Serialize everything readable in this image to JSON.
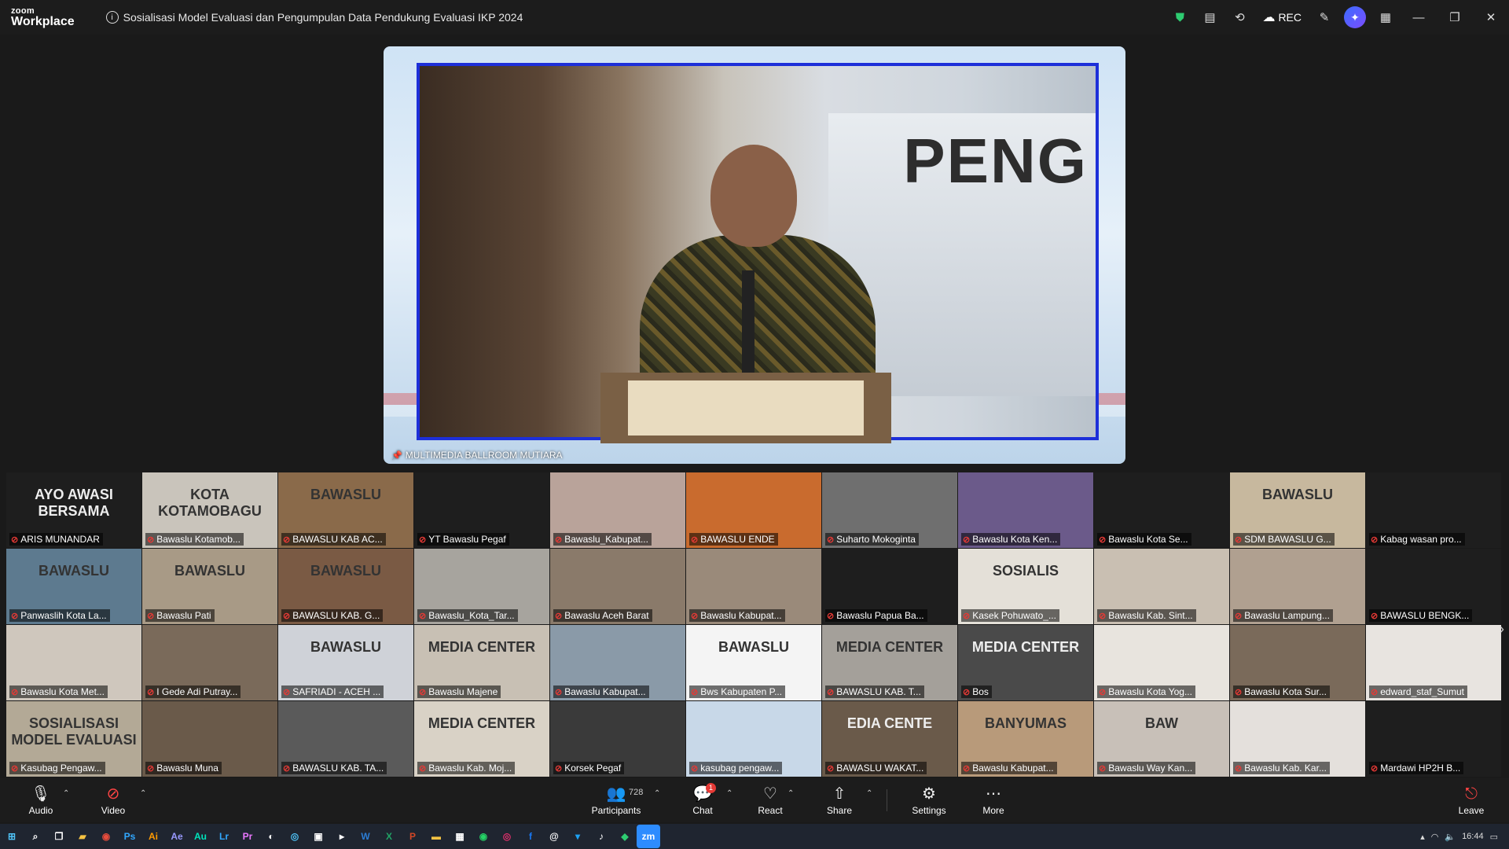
{
  "app": {
    "brand_small": "zoom",
    "brand_large": "Workplace",
    "meeting_title": "Sosialisasi Model Evaluasi dan Pengumpulan Data Pendukung Evaluasi IKP 2024",
    "rec_label": "REC"
  },
  "stage": {
    "speaker_label": "MULTIMEDIA BALLROOM MUTIARA",
    "banner_text": "PENG"
  },
  "participants": [
    {
      "name": "ARIS MUNANDAR",
      "bg": "#1e1e1e",
      "logo": "AYO AWASI BERSAMA"
    },
    {
      "name": "Bawaslu Kotamob...",
      "bg": "#c9c4bb",
      "logo": "KOTA KOTAMOBAGU"
    },
    {
      "name": "BAWASLU KAB AC...",
      "bg": "#8a6a4a",
      "logo": "BAWASLU"
    },
    {
      "name": "YT Bawaslu Pegaf",
      "bg": "#1e1e1e",
      "logo": ""
    },
    {
      "name": "Bawaslu_Kabupat...",
      "bg": "#b9a39a",
      "logo": ""
    },
    {
      "name": "BAWASLU ENDE",
      "bg": "#c96b2e",
      "logo": ""
    },
    {
      "name": "Suharto Mokoginta",
      "bg": "#6f6f6f",
      "logo": ""
    },
    {
      "name": "Bawaslu Kota Ken...",
      "bg": "#6b5a8a",
      "logo": ""
    },
    {
      "name": "Bawaslu Kota Se...",
      "bg": "#1e1e1e",
      "logo": ""
    },
    {
      "name": "SDM BAWASLU G...",
      "bg": "#c7b89e",
      "logo": "BAWASLU"
    },
    {
      "name": "Kabag wasan pro...",
      "bg": "#1e1e1e",
      "logo": ""
    },
    {
      "name": "Panwaslih Kota La...",
      "bg": "#5d7a8f",
      "logo": "BAWASLU"
    },
    {
      "name": "Bawaslu Pati",
      "bg": "#a89a86",
      "logo": "BAWASLU"
    },
    {
      "name": "BAWASLU KAB. G...",
      "bg": "#7a5a44",
      "logo": "BAWASLU"
    },
    {
      "name": "Bawaslu_Kota_Tar...",
      "bg": "#a7a49e",
      "logo": ""
    },
    {
      "name": "Bawaslu Aceh Barat",
      "bg": "#8a7a6a",
      "logo": ""
    },
    {
      "name": "Bawaslu Kabupat...",
      "bg": "#9a8a7a",
      "logo": ""
    },
    {
      "name": "Bawaslu Papua Ba...",
      "bg": "#1e1e1e",
      "logo": ""
    },
    {
      "name": "Kasek Pohuwato_...",
      "bg": "#e4e0d8",
      "logo": "SOSIALIS"
    },
    {
      "name": "Bawaslu Kab. Sint...",
      "bg": "#c9bfb2",
      "logo": ""
    },
    {
      "name": "Bawaslu Lampung...",
      "bg": "#b0a090",
      "logo": ""
    },
    {
      "name": "BAWASLU BENGK...",
      "bg": "#1e1e1e",
      "logo": ""
    },
    {
      "name": "Bawaslu Kota Met...",
      "bg": "#cfc7bd",
      "logo": ""
    },
    {
      "name": "I Gede Adi Putray...",
      "bg": "#7a6a5a",
      "logo": ""
    },
    {
      "name": "SAFRIADI - ACEH ...",
      "bg": "#cfd2d8",
      "logo": "BAWASLU"
    },
    {
      "name": "Bawaslu Majene",
      "bg": "#c8c0b4",
      "logo": "MEDIA CENTER"
    },
    {
      "name": "Bawaslu Kabupat...",
      "bg": "#8a9aa8",
      "logo": ""
    },
    {
      "name": "Bws Kabupaten P...",
      "bg": "#f4f4f4",
      "logo": "BAWASLU"
    },
    {
      "name": "BAWASLU KAB. T...",
      "bg": "#a4a09a",
      "logo": "MEDIA CENTER"
    },
    {
      "name": "Bos",
      "bg": "#4a4a4a",
      "logo": "MEDIA CENTER"
    },
    {
      "name": "Bawaslu Kota Yog...",
      "bg": "#e8e4de",
      "logo": ""
    },
    {
      "name": "Bawaslu Kota Sur...",
      "bg": "#7a6a5a",
      "logo": ""
    },
    {
      "name": "edward_staf_Sumut",
      "bg": "#e8e4e0",
      "logo": ""
    },
    {
      "name": "Kasubag Pengaw...",
      "bg": "#b3a996",
      "logo": "SOSIALISASI MODEL EVALUASI"
    },
    {
      "name": "Bawaslu Muna",
      "bg": "#6a5a4a",
      "logo": ""
    },
    {
      "name": "BAWASLU KAB. TA...",
      "bg": "#5a5a5a",
      "logo": ""
    },
    {
      "name": "Bawaslu Kab. Moj...",
      "bg": "#d9d2c6",
      "logo": "MEDIA CENTER"
    },
    {
      "name": "Korsek Pegaf",
      "bg": "#3a3a3a",
      "logo": ""
    },
    {
      "name": "kasubag pengaw...",
      "bg": "#c8d8e8",
      "logo": ""
    },
    {
      "name": "BAWASLU WAKAT...",
      "bg": "#6a5a4a",
      "logo": "EDIA CENTE"
    },
    {
      "name": "Bawaslu Kabupat...",
      "bg": "#b89a7a",
      "logo": "BANYUMAS"
    },
    {
      "name": "Bawaslu Way Kan...",
      "bg": "#c8c0b8",
      "logo": "BAW"
    },
    {
      "name": "Bawaslu Kab. Kar...",
      "bg": "#e4e0dc",
      "logo": ""
    },
    {
      "name": "Mardawi HP2H B...",
      "bg": "#1e1e1e",
      "logo": ""
    }
  ],
  "toolbar": {
    "audio": "Audio",
    "video": "Video",
    "participants": "Participants",
    "participants_count": "728",
    "chat": "Chat",
    "chat_badge": "1",
    "react": "React",
    "share": "Share",
    "settings": "Settings",
    "more": "More",
    "leave": "Leave"
  },
  "taskbar": {
    "clock": "16:44"
  }
}
